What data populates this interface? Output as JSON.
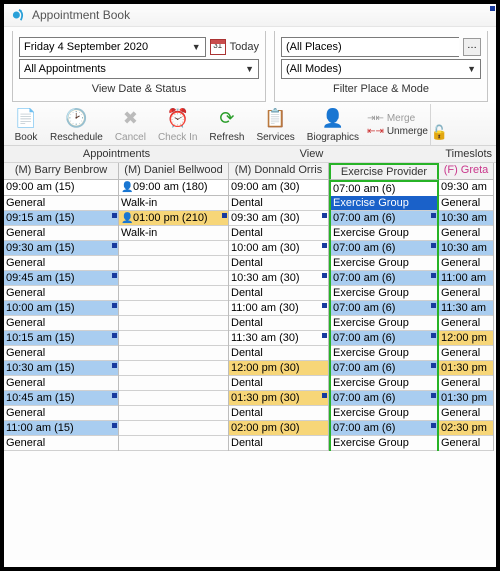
{
  "window": {
    "title": "Appointment Book"
  },
  "dateStatus": {
    "date": "Friday 4 September 2020",
    "today_label": "Today",
    "appointments": "All Appointments",
    "panel_label": "View Date & Status"
  },
  "placeMode": {
    "places": "(All Places)",
    "modes": "(All Modes)",
    "panel_label": "Filter Place & Mode"
  },
  "toolbar": {
    "book": "Book",
    "reschedule": "Reschedule",
    "cancel": "Cancel",
    "checkin": "Check In",
    "refresh": "Refresh",
    "services": "Services",
    "biographics": "Biographics",
    "merge": "Merge",
    "unmerge": "Unmerge"
  },
  "sections": {
    "appointments": "Appointments",
    "view": "View",
    "timeslots": "Timeslots"
  },
  "providers": {
    "p0": "(M) Barry Benbrow",
    "p1": "(M) Daniel Bellwood",
    "p2": "(M) Donnald Orris",
    "p3": "Exercise Provider",
    "p4": "(F) Greta"
  },
  "times": {
    "t0": "09:00 am (15)",
    "t1": "09:00 am (180)",
    "t2": "09:00 am (30)",
    "t3": "07:00 am (6)",
    "t4": "09:30 am"
  },
  "rows": [
    {
      "c0": "General",
      "c1": "Walk-in",
      "c2": "Dental",
      "c3": "Exercise Group",
      "c4": "General"
    },
    {
      "c0": "09:15 am (15)",
      "c1": "01:00 pm (210)",
      "c2": "09:30 am (30)",
      "c3": "07:00 am (6)",
      "c4": "10:30 am"
    },
    {
      "c0": "General",
      "c1": "Walk-in",
      "c2": "Dental",
      "c3": "Exercise Group",
      "c4": "General"
    },
    {
      "c0": "09:30 am (15)",
      "c1": "",
      "c2": "10:00 am (30)",
      "c3": "07:00 am (6)",
      "c4": "10:30 am"
    },
    {
      "c0": "General",
      "c1": "",
      "c2": "Dental",
      "c3": "Exercise Group",
      "c4": "General"
    },
    {
      "c0": "09:45 am (15)",
      "c1": "",
      "c2": "10:30 am (30)",
      "c3": "07:00 am (6)",
      "c4": "11:00 am"
    },
    {
      "c0": "General",
      "c1": "",
      "c2": "Dental",
      "c3": "Exercise Group",
      "c4": "General"
    },
    {
      "c0": "10:00 am (15)",
      "c1": "",
      "c2": "11:00 am (30)",
      "c3": "07:00 am (6)",
      "c4": "11:30 am"
    },
    {
      "c0": "General",
      "c1": "",
      "c2": "Dental",
      "c3": "Exercise Group",
      "c4": "General"
    },
    {
      "c0": "10:15 am (15)",
      "c1": "",
      "c2": "11:30 am (30)",
      "c3": "07:00 am (6)",
      "c4": "12:00 pm"
    },
    {
      "c0": "General",
      "c1": "",
      "c2": "Dental",
      "c3": "Exercise Group",
      "c4": "General"
    },
    {
      "c0": "10:30 am (15)",
      "c1": "",
      "c2": "12:00 pm (30)",
      "c3": "07:00 am (6)",
      "c4": "01:30 pm"
    },
    {
      "c0": "General",
      "c1": "",
      "c2": "Dental",
      "c3": "Exercise Group",
      "c4": "General"
    },
    {
      "c0": "10:45 am (15)",
      "c1": "",
      "c2": "01:30 pm (30)",
      "c3": "07:00 am (6)",
      "c4": "01:30 pm"
    },
    {
      "c0": "General",
      "c1": "",
      "c2": "Dental",
      "c3": "Exercise Group",
      "c4": "General"
    },
    {
      "c0": "11:00 am (15)",
      "c1": "",
      "c2": "02:00 pm (30)",
      "c3": "07:00 am (6)",
      "c4": "02:30 pm"
    },
    {
      "c0": "General",
      "c1": "",
      "c2": "Dental",
      "c3": "Exercise Group",
      "c4": "General"
    }
  ],
  "rowStyles": {
    "time_blue": [
      "0",
      "2",
      "4",
      "6",
      "8",
      "14"
    ],
    "time_yellow": [
      "10",
      "12"
    ],
    "r0_c1_blue": true
  }
}
